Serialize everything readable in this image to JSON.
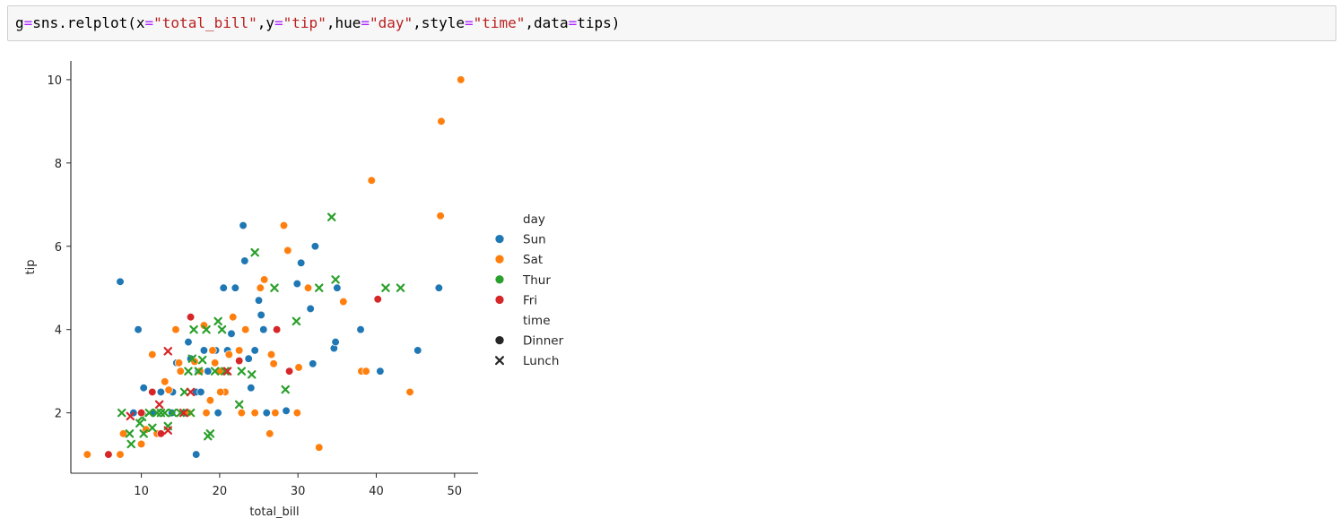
{
  "cell": {
    "code_tokens": [
      {
        "t": "g",
        "c": "name"
      },
      {
        "t": "=",
        "c": "op"
      },
      {
        "t": "sns.relplot(x",
        "c": "name"
      },
      {
        "t": "=",
        "c": "op"
      },
      {
        "t": "\"total_bill\"",
        "c": "str"
      },
      {
        "t": ",y",
        "c": "name"
      },
      {
        "t": "=",
        "c": "op"
      },
      {
        "t": "\"tip\"",
        "c": "str"
      },
      {
        "t": ",hue",
        "c": "name"
      },
      {
        "t": "=",
        "c": "op"
      },
      {
        "t": "\"day\"",
        "c": "str"
      },
      {
        "t": ",style",
        "c": "name"
      },
      {
        "t": "=",
        "c": "op"
      },
      {
        "t": "\"time\"",
        "c": "str"
      },
      {
        "t": ",data",
        "c": "name"
      },
      {
        "t": "=",
        "c": "op"
      },
      {
        "t": "tips)",
        "c": "name"
      }
    ]
  },
  "chart_data": {
    "type": "scatter",
    "xlabel": "total_bill",
    "ylabel": "tip",
    "xlim": [
      1.0,
      53.0
    ],
    "ylim": [
      0.55,
      10.45
    ],
    "xticks": [
      10,
      20,
      30,
      40,
      50
    ],
    "yticks": [
      2,
      4,
      6,
      8,
      10
    ],
    "grid": false,
    "legend_placement": "right",
    "legend": {
      "hue_title": "day",
      "hue_entries": [
        {
          "label": "Sun",
          "color": "#1f77b4"
        },
        {
          "label": "Sat",
          "color": "#ff7f0e"
        },
        {
          "label": "Thur",
          "color": "#2ca02c"
        },
        {
          "label": "Fri",
          "color": "#d62728"
        }
      ],
      "style_title": "time",
      "style_entries": [
        {
          "label": "Dinner",
          "marker": "circle"
        },
        {
          "label": "Lunch",
          "marker": "x"
        }
      ]
    },
    "series": [
      {
        "name": "Sun",
        "time": "Dinner",
        "color": "#1f77b4",
        "marker": "circle",
        "points": [
          [
            7.3,
            5.15
          ],
          [
            9.6,
            4.0
          ],
          [
            10.3,
            2.6
          ],
          [
            12.5,
            2.5
          ],
          [
            14.0,
            2.5
          ],
          [
            14.5,
            3.2
          ],
          [
            15.0,
            3.0
          ],
          [
            15.5,
            2.0
          ],
          [
            16.0,
            3.7
          ],
          [
            16.3,
            3.3
          ],
          [
            17.0,
            2.5
          ],
          [
            17.3,
            3.0
          ],
          [
            18.0,
            3.5
          ],
          [
            18.5,
            3.0
          ],
          [
            19.5,
            3.5
          ],
          [
            20.3,
            3.0
          ],
          [
            21.0,
            3.5
          ],
          [
            21.5,
            3.9
          ],
          [
            22.0,
            5.0
          ],
          [
            23.0,
            6.5
          ],
          [
            23.2,
            5.65
          ],
          [
            23.7,
            3.3
          ],
          [
            24.0,
            2.6
          ],
          [
            24.5,
            3.5
          ],
          [
            25.0,
            4.7
          ],
          [
            25.3,
            4.35
          ],
          [
            25.6,
            4.0
          ],
          [
            29.9,
            5.1
          ],
          [
            30.4,
            5.6
          ],
          [
            31.6,
            4.5
          ],
          [
            32.2,
            6.0
          ],
          [
            34.6,
            3.55
          ],
          [
            34.8,
            3.7
          ],
          [
            35.0,
            5.0
          ],
          [
            38.0,
            4.0
          ],
          [
            40.5,
            3.0
          ],
          [
            45.3,
            3.5
          ],
          [
            48.0,
            5.0
          ],
          [
            17.0,
            1.0
          ],
          [
            19.8,
            2.0
          ],
          [
            26.0,
            2.0
          ],
          [
            31.9,
            3.18
          ],
          [
            28.5,
            2.05
          ],
          [
            20.5,
            5.0
          ],
          [
            17.6,
            2.5
          ],
          [
            11.5,
            2.0
          ],
          [
            9.0,
            2.0
          ],
          [
            13.9,
            2.0
          ]
        ]
      },
      {
        "name": "Sat",
        "time": "Dinner",
        "color": "#ff7f0e",
        "marker": "circle",
        "points": [
          [
            3.1,
            1.0
          ],
          [
            7.3,
            1.0
          ],
          [
            7.7,
            1.5
          ],
          [
            10.0,
            1.25
          ],
          [
            10.6,
            1.6
          ],
          [
            11.4,
            3.4
          ],
          [
            12.5,
            1.5
          ],
          [
            13.0,
            2.75
          ],
          [
            13.5,
            2.55
          ],
          [
            14.4,
            4.0
          ],
          [
            15.0,
            3.0
          ],
          [
            16.0,
            2.0
          ],
          [
            17.5,
            3.0
          ],
          [
            18.0,
            4.1
          ],
          [
            18.3,
            2.0
          ],
          [
            18.8,
            2.3
          ],
          [
            19.4,
            3.2
          ],
          [
            20.0,
            3.0
          ],
          [
            20.7,
            2.5
          ],
          [
            21.2,
            3.4
          ],
          [
            21.7,
            4.3
          ],
          [
            22.5,
            3.5
          ],
          [
            22.8,
            2.0
          ],
          [
            24.5,
            2.0
          ],
          [
            25.2,
            5.0
          ],
          [
            25.7,
            5.2
          ],
          [
            26.4,
            1.5
          ],
          [
            26.6,
            3.4
          ],
          [
            26.9,
            3.18
          ],
          [
            28.2,
            6.5
          ],
          [
            28.7,
            5.9
          ],
          [
            29.9,
            2.0
          ],
          [
            30.1,
            3.09
          ],
          [
            31.3,
            5.0
          ],
          [
            32.7,
            1.17
          ],
          [
            35.8,
            4.67
          ],
          [
            38.1,
            3.0
          ],
          [
            38.7,
            3.0
          ],
          [
            39.4,
            7.58
          ],
          [
            44.3,
            2.5
          ],
          [
            48.2,
            6.73
          ],
          [
            48.3,
            9.0
          ],
          [
            50.8,
            10.0
          ],
          [
            27.1,
            2.0
          ],
          [
            16.8,
            3.23
          ],
          [
            20.1,
            2.5
          ],
          [
            12.0,
            1.5
          ],
          [
            14.8,
            3.2
          ],
          [
            19.1,
            3.5
          ],
          [
            23.3,
            4.0
          ]
        ]
      },
      {
        "name": "Thur",
        "time": "Lunch",
        "color": "#2ca02c",
        "marker": "x",
        "points": [
          [
            7.5,
            2.0
          ],
          [
            8.5,
            1.5
          ],
          [
            8.7,
            1.25
          ],
          [
            9.8,
            1.75
          ],
          [
            10.1,
            1.9
          ],
          [
            10.3,
            1.5
          ],
          [
            11.0,
            2.0
          ],
          [
            11.4,
            1.64
          ],
          [
            12.0,
            2.0
          ],
          [
            12.5,
            2.0
          ],
          [
            13.0,
            2.0
          ],
          [
            13.4,
            1.68
          ],
          [
            14.0,
            2.0
          ],
          [
            15.0,
            2.0
          ],
          [
            15.5,
            2.5
          ],
          [
            16.0,
            3.0
          ],
          [
            16.5,
            3.3
          ],
          [
            16.7,
            4.0
          ],
          [
            17.3,
            3.0
          ],
          [
            17.8,
            3.27
          ],
          [
            18.3,
            4.0
          ],
          [
            18.5,
            1.44
          ],
          [
            18.8,
            1.5
          ],
          [
            19.4,
            3.0
          ],
          [
            19.8,
            4.2
          ],
          [
            20.3,
            4.0
          ],
          [
            20.7,
            3.0
          ],
          [
            22.8,
            3.0
          ],
          [
            22.5,
            2.2
          ],
          [
            24.5,
            5.85
          ],
          [
            27.0,
            5.0
          ],
          [
            28.4,
            2.56
          ],
          [
            29.8,
            4.2
          ],
          [
            32.7,
            5.0
          ],
          [
            34.3,
            6.7
          ],
          [
            34.8,
            5.2
          ],
          [
            41.2,
            5.0
          ],
          [
            43.1,
            5.0
          ],
          [
            24.1,
            2.92
          ],
          [
            16.3,
            2.0
          ]
        ]
      },
      {
        "name": "Fri",
        "time": "Dinner",
        "color": "#d62728",
        "marker": "circle",
        "points": [
          [
            5.8,
            1.0
          ],
          [
            11.4,
            2.5
          ],
          [
            16.3,
            4.3
          ],
          [
            22.5,
            3.25
          ],
          [
            27.3,
            4.0
          ],
          [
            28.9,
            3.0
          ],
          [
            40.2,
            4.73
          ],
          [
            12.5,
            1.5
          ],
          [
            10.0,
            2.0
          ]
        ]
      },
      {
        "name": "Fri",
        "time": "Lunch",
        "color": "#d62728",
        "marker": "x",
        "points": [
          [
            8.6,
            1.92
          ],
          [
            12.3,
            2.2
          ],
          [
            13.4,
            3.48
          ],
          [
            13.4,
            1.58
          ],
          [
            15.4,
            2.0
          ],
          [
            16.3,
            2.5
          ],
          [
            21.0,
            3.0
          ]
        ]
      }
    ]
  }
}
